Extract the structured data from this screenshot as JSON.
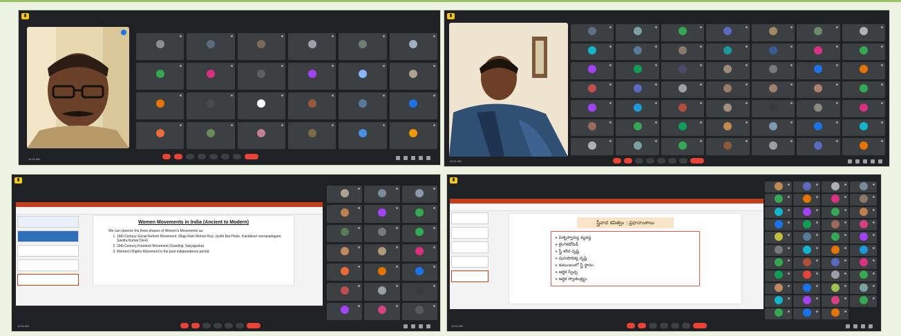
{
  "colors": {
    "page_background": "#eef3e4",
    "panel_background": "#202124",
    "tile_background": "#3c4043",
    "end_call": "#ea4335",
    "app_badge": "#f2c811"
  },
  "panels": [
    {
      "id": "panel-1",
      "presenter_name": "",
      "meeting_time": "11:01 AM",
      "meeting_code": "",
      "participants": [
        {
          "name": "",
          "color": "#8e8e8e"
        },
        {
          "name": "",
          "color": "#5b6b7b"
        },
        {
          "name": "",
          "color": "#7a6a5a"
        },
        {
          "name": "",
          "color": "#9aa0a6"
        },
        {
          "name": "",
          "color": "#6f7f6f"
        },
        {
          "name": "",
          "color": "#a0b0c0"
        },
        {
          "name": "",
          "color": "#34a853"
        },
        {
          "name": "",
          "color": "#d93080"
        },
        {
          "name": "",
          "color": "#5f5f5f"
        },
        {
          "name": "",
          "color": "#a142f4"
        },
        {
          "name": "",
          "color": "#8ab4f8"
        },
        {
          "name": "",
          "color": "#b0a090"
        },
        {
          "name": "",
          "color": "#e37400"
        },
        {
          "name": "",
          "color": "#4a4a4a"
        },
        {
          "name": "",
          "color": "#ffffff"
        },
        {
          "name": "",
          "color": "#9a5a3a"
        },
        {
          "name": "",
          "color": "#5a7a9a"
        },
        {
          "name": "",
          "color": "#1a73e8"
        },
        {
          "name": "",
          "color": "#ea6a3a"
        },
        {
          "name": "",
          "color": "#6a8a5a"
        },
        {
          "name": "",
          "color": "#c08090"
        },
        {
          "name": "",
          "color": "#7a6a4a"
        },
        {
          "name": "",
          "color": "#4a90e2"
        },
        {
          "name": "",
          "color": "#f29900"
        }
      ]
    },
    {
      "id": "panel-2",
      "presenter_name": "",
      "meeting_time": "11:01 AM",
      "meeting_code": "",
      "participants": [
        {
          "name": "",
          "color": "#607080"
        },
        {
          "name": "",
          "color": "#7aa0a0"
        },
        {
          "name": "",
          "color": "#34a853"
        },
        {
          "name": "",
          "color": "#5c6bc0"
        },
        {
          "name": "",
          "color": "#a08a60"
        },
        {
          "name": "",
          "color": "#6a8a6a"
        },
        {
          "name": "",
          "color": "#b0b0b0"
        },
        {
          "name": "",
          "color": "#12b5cb"
        },
        {
          "name": "",
          "color": "#5a7a9a"
        },
        {
          "name": "",
          "color": "#8a7a6a"
        },
        {
          "name": "",
          "color": "#1a9a9a"
        },
        {
          "name": "",
          "color": "#3a5a9a"
        },
        {
          "name": "",
          "color": "#d93080"
        },
        {
          "name": "",
          "color": "#34a853"
        },
        {
          "name": "",
          "color": "#a142f4"
        },
        {
          "name": "",
          "color": "#0f9d58"
        },
        {
          "name": "",
          "color": "#4a4a6a"
        },
        {
          "name": "",
          "color": "#9a8a7a"
        },
        {
          "name": "",
          "color": "#7a7a7a"
        },
        {
          "name": "",
          "color": "#1a73e8"
        },
        {
          "name": "",
          "color": "#e37400"
        },
        {
          "name": "",
          "color": "#c0504d"
        },
        {
          "name": "",
          "color": "#5c6bc0"
        },
        {
          "name": "",
          "color": "#9aa0a6"
        },
        {
          "name": "",
          "color": "#9a7a6a"
        },
        {
          "name": "",
          "color": "#a08070"
        },
        {
          "name": "",
          "color": "#b08070"
        },
        {
          "name": "",
          "color": "#34a853"
        },
        {
          "name": "",
          "color": "#a142f4"
        },
        {
          "name": "",
          "color": "#1a9ad6"
        },
        {
          "name": "",
          "color": "#b0503a"
        },
        {
          "name": "",
          "color": "#a09080"
        },
        {
          "name": "",
          "color": "#3a3a3a"
        },
        {
          "name": "",
          "color": "#8a8a7a"
        },
        {
          "name": "",
          "color": "#d93080"
        },
        {
          "name": "",
          "color": "#9a6a5a"
        },
        {
          "name": "",
          "color": "#34a853"
        },
        {
          "name": "",
          "color": "#0f9d58"
        },
        {
          "name": "",
          "color": "#c08a50"
        },
        {
          "name": "",
          "color": "#7a9ab0"
        },
        {
          "name": "",
          "color": "#1a73e8"
        },
        {
          "name": "",
          "color": "#12b5cb"
        },
        {
          "name": "",
          "color": "#b0b0b0"
        },
        {
          "name": "",
          "color": "#7aa0a0"
        },
        {
          "name": "",
          "color": "#34a853"
        },
        {
          "name": "",
          "color": "#8a5a3a"
        },
        {
          "name": "",
          "color": "#9aa0a6"
        },
        {
          "name": "",
          "color": "#5c6bc0"
        },
        {
          "name": "",
          "color": "#e37400"
        }
      ]
    },
    {
      "id": "panel-3",
      "window_title": "",
      "meeting_time": "11:01 AM",
      "meeting_code": "",
      "slide": {
        "title": "Women Movements in India (Ancient to Modern)",
        "intro": "We can observe the three phases of Women's Movements as:",
        "items": [
          "19th Century Social Reform Movement: (Raja Ram Mohan Roy, Jyothi Bai Phule, Kandukuri veerasalingam, Savitra Kumar Devi)",
          "20th Century Freedom Movement (Gandhiji, Satyagraha)",
          "Women's Rights Movement in the post independence period"
        ]
      },
      "participants": [
        {
          "name": "",
          "color": "#b0a090"
        },
        {
          "name": "",
          "color": "#7a8a9a"
        },
        {
          "name": "",
          "color": "#8a9aaa"
        },
        {
          "name": "",
          "color": "#c0804a"
        },
        {
          "name": "",
          "color": "#a142f4"
        },
        {
          "name": "",
          "color": "#34a853"
        },
        {
          "name": "",
          "color": "#5a7a5a"
        },
        {
          "name": "",
          "color": "#7a7a7a"
        },
        {
          "name": "",
          "color": "#34a853"
        },
        {
          "name": "",
          "color": "#c08a60"
        },
        {
          "name": "",
          "color": "#b09a7a"
        },
        {
          "name": "",
          "color": "#d93080"
        },
        {
          "name": "",
          "color": "#ea6a3a"
        },
        {
          "name": "",
          "color": "#e37400"
        },
        {
          "name": "",
          "color": "#1a73e8"
        },
        {
          "name": "",
          "color": "#c0504d"
        },
        {
          "name": "",
          "color": "#9aa0a6"
        },
        {
          "name": "",
          "color": "#3a3a3a"
        },
        {
          "name": "",
          "color": "#a142f4"
        },
        {
          "name": "",
          "color": "#d94080"
        },
        {
          "name": "",
          "color": "#5a5a5a"
        }
      ]
    },
    {
      "id": "panel-4",
      "window_title": "",
      "meeting_time": "11:01 AM",
      "meeting_code": "",
      "slide": {
        "title": "స్త్రీవాద కవిత్వం - ప్రధానాంశాలు",
        "items": [
          "పితృస్వామ్య వ్యవస్థ",
          "లైంగికదోపిడీ",
          "స్త్రీ శరీర దృష్టి",
          "పురుషాధిక్య దృష్టి",
          "కుటుంబంలో స్త్రీ స్థానం",
          "ఆర్థిక స్వేచ్ఛ",
          "ఆర్థిక స్వాతంత్ర్యం"
        ]
      },
      "participants": [
        {
          "name": "",
          "color": "#c08a50"
        },
        {
          "name": "",
          "color": "#5c6bc0"
        },
        {
          "name": "",
          "color": "#b0b0b0"
        },
        {
          "name": "",
          "color": "#7a8a9a"
        },
        {
          "name": "",
          "color": "#34a853"
        },
        {
          "name": "",
          "color": "#e37400"
        },
        {
          "name": "",
          "color": "#d93080"
        },
        {
          "name": "",
          "color": "#8a7a6a"
        },
        {
          "name": "",
          "color": "#12b5cb"
        },
        {
          "name": "",
          "color": "#a142f4"
        },
        {
          "name": "",
          "color": "#34a853"
        },
        {
          "name": "",
          "color": "#c0804a"
        },
        {
          "name": "",
          "color": "#1a73e8"
        },
        {
          "name": "",
          "color": "#0f9d58"
        },
        {
          "name": "",
          "color": "#9a6a5a"
        },
        {
          "name": "",
          "color": "#d94080"
        },
        {
          "name": "",
          "color": "#c0c040"
        },
        {
          "name": "",
          "color": "#5a7a9a"
        },
        {
          "name": "",
          "color": "#34a853"
        },
        {
          "name": "",
          "color": "#a142f4"
        },
        {
          "name": "",
          "color": "#7a7a7a"
        },
        {
          "name": "",
          "color": "#12b5cb"
        },
        {
          "name": "",
          "color": "#e37400"
        },
        {
          "name": "",
          "color": "#1a9ad6"
        },
        {
          "name": "",
          "color": "#34a853"
        },
        {
          "name": "",
          "color": "#b0503a"
        },
        {
          "name": "",
          "color": "#5c6bc0"
        },
        {
          "name": "",
          "color": "#d93080"
        },
        {
          "name": "",
          "color": "#0f9d58"
        },
        {
          "name": "",
          "color": "#ea4335"
        },
        {
          "name": "",
          "color": "#9aa0a6"
        },
        {
          "name": "",
          "color": "#34a853"
        },
        {
          "name": "",
          "color": "#c08a60"
        },
        {
          "name": "",
          "color": "#1a73e8"
        },
        {
          "name": "",
          "color": "#a0c050"
        },
        {
          "name": "",
          "color": "#7aa0a0"
        },
        {
          "name": "",
          "color": "#12b5cb"
        },
        {
          "name": "",
          "color": "#a142f4"
        },
        {
          "name": "",
          "color": "#d94080"
        },
        {
          "name": "",
          "color": "#34a853"
        },
        {
          "name": "",
          "color": "#34a853"
        },
        {
          "name": "",
          "color": "#1a73e8"
        },
        {
          "name": "",
          "color": "#e37400"
        }
      ]
    }
  ]
}
